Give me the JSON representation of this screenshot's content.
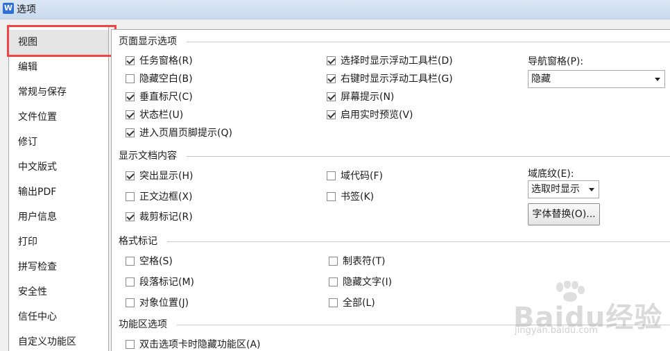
{
  "window": {
    "app_icon": "W",
    "title": "选项"
  },
  "sidebar": {
    "items": [
      {
        "label": "视图"
      },
      {
        "label": "编辑"
      },
      {
        "label": "常规与保存"
      },
      {
        "label": "文件位置"
      },
      {
        "label": "修订"
      },
      {
        "label": "中文版式"
      },
      {
        "label": "输出PDF"
      },
      {
        "label": "用户信息"
      },
      {
        "label": "打印"
      },
      {
        "label": "拼写检查"
      },
      {
        "label": "安全性"
      },
      {
        "label": "信任中心"
      },
      {
        "label": "自定义功能区"
      }
    ]
  },
  "sections": {
    "page_display": {
      "title": "页面显示选项",
      "options": [
        {
          "label": "任务窗格(R)",
          "checked": true
        },
        {
          "label": "隐藏空白(B)",
          "checked": false
        },
        {
          "label": "垂直标尺(C)",
          "checked": true
        },
        {
          "label": "状态栏(U)",
          "checked": true
        },
        {
          "label": "进入页眉页脚提示(Q)",
          "checked": true
        },
        {
          "label": "选择时显示浮动工具栏(D)",
          "checked": true
        },
        {
          "label": "右键时显示浮动工具栏(G)",
          "checked": true
        },
        {
          "label": "屏幕提示(N)",
          "checked": true
        },
        {
          "label": "启用实时预览(V)",
          "checked": true
        }
      ],
      "nav_pane_label": "导航窗格(P):",
      "nav_pane_value": "隐藏"
    },
    "doc_content": {
      "title": "显示文档内容",
      "options": [
        {
          "label": "突出显示(H)",
          "checked": true
        },
        {
          "label": "正文边框(X)",
          "checked": false
        },
        {
          "label": "裁剪标记(R)",
          "checked": true
        },
        {
          "label": "域代码(F)",
          "checked": false
        },
        {
          "label": "书签(K)",
          "checked": false
        }
      ],
      "field_shading_label": "域底纹(E):",
      "field_shading_value": "选取时显示",
      "font_sub_button": "字体替换(O)..."
    },
    "format_marks": {
      "title": "格式标记",
      "options": [
        {
          "label": "空格(S)",
          "checked": false
        },
        {
          "label": "段落标记(M)",
          "checked": false
        },
        {
          "label": "对象位置(J)",
          "checked": false
        },
        {
          "label": "制表符(T)",
          "checked": false
        },
        {
          "label": "隐藏文字(I)",
          "checked": false
        },
        {
          "label": "全部(L)",
          "checked": false
        }
      ]
    },
    "ribbon": {
      "title": "功能区选项",
      "options": [
        {
          "label": "双击选项卡时隐藏功能区(A)",
          "checked": false
        }
      ]
    }
  },
  "watermark": {
    "text": "Baidu经验",
    "url": "jingyan.baidu.com"
  }
}
